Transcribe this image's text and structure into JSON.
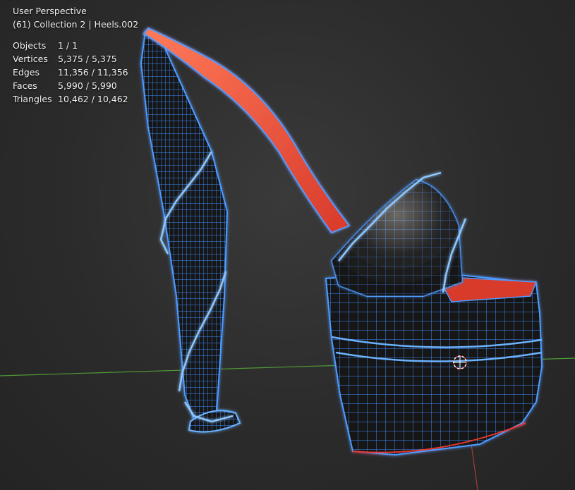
{
  "viewport": {
    "view_name": "User Perspective",
    "object_info": "(61) Collection 2 | Heels.002",
    "stats": [
      {
        "label": "Objects",
        "value": "1 / 1"
      },
      {
        "label": "Vertices",
        "value": "5,375 / 5,375"
      },
      {
        "label": "Edges",
        "value": "11,356 / 11,356"
      },
      {
        "label": "Faces",
        "value": "5,990 / 5,990"
      },
      {
        "label": "Triangles",
        "value": "10,462 / 10,462"
      }
    ]
  },
  "colors": {
    "wire": "#3f8cff",
    "wire_bright": "#8fc8ff",
    "sole_red": "#e8392c",
    "x_axis": "#4f9a38",
    "y_axis": "#a83a3a",
    "cursor_red": "#e23b2f"
  }
}
